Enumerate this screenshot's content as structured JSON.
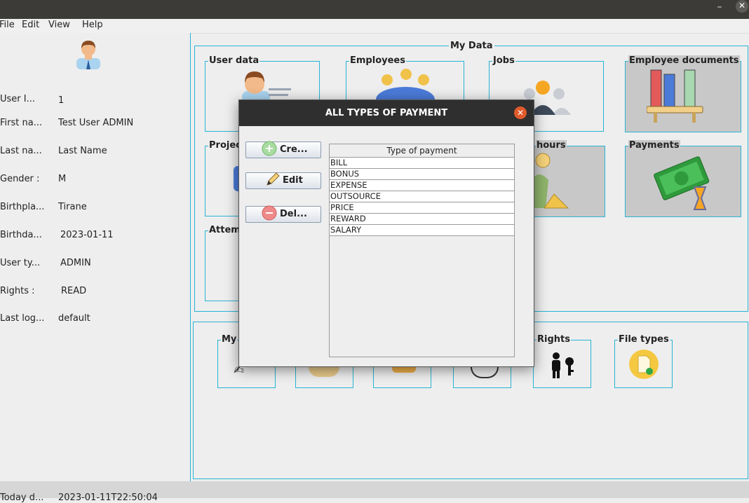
{
  "window": {
    "minimize_label": "–",
    "close_label": "✕"
  },
  "menubar": {
    "items": [
      "File",
      "Edit",
      "View",
      "Help"
    ]
  },
  "profile": {
    "fields": [
      {
        "label": "User I...",
        "value": "1"
      },
      {
        "label": "First na...",
        "value": "Test User ADMIN"
      },
      {
        "label": "Last na...",
        "value": "Last Name"
      },
      {
        "label": "Gender :",
        "value": "M"
      },
      {
        "label": "Birthpla...",
        "value": "Tirane"
      },
      {
        "label": "Birthda...",
        "value": "2023-01-11"
      },
      {
        "label": "User ty...",
        "value": "ADMIN"
      },
      {
        "label": "Rights  :",
        "value": "READ"
      },
      {
        "label": "Last log...",
        "value": "default"
      }
    ]
  },
  "my_data": {
    "title": "My Data",
    "tiles": [
      "User data",
      "Employees",
      "Jobs",
      "Employee documents",
      "Projec",
      "hours",
      "Payments",
      "Attem"
    ]
  },
  "bottom_tiles": [
    "My",
    "Rights",
    "File types"
  ],
  "status": {
    "label": "Today d...",
    "value": "2023-01-11T22:50:04"
  },
  "dialog": {
    "title": "ALL TYPES OF PAYMENT",
    "close_label": "✕",
    "buttons": {
      "create": "Cre...",
      "edit": "Edit",
      "delete": "Del..."
    },
    "table": {
      "header": "Type of payment",
      "rows": [
        "BILL",
        "BONUS",
        "EXPENSE",
        "OUTSOURCE",
        "PRICE",
        "REWARD",
        "SALARY"
      ]
    }
  }
}
